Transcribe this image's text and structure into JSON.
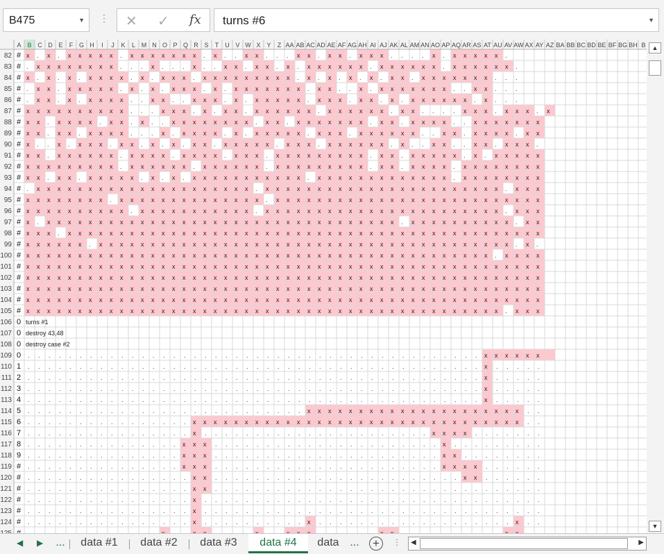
{
  "namebox": {
    "value": "B475"
  },
  "formula": {
    "value": "turns #6"
  },
  "function_icon": "fx",
  "columns": [
    "A",
    "B",
    "C",
    "D",
    "E",
    "F",
    "G",
    "H",
    "I",
    "J",
    "K",
    "L",
    "M",
    "N",
    "O",
    "P",
    "Q",
    "R",
    "S",
    "T",
    "U",
    "V",
    "W",
    "X",
    "Y",
    "Z",
    "AA",
    "AB",
    "AC",
    "AD",
    "AE",
    "AF",
    "AG",
    "AH",
    "AI",
    "AJ",
    "AK",
    "AL",
    "AM",
    "AN",
    "AO",
    "AP",
    "AQ",
    "AR",
    "AS",
    "AT",
    "AU",
    "AV",
    "AW",
    "AX",
    "AY",
    "AZ",
    "BA",
    "BB",
    "BC",
    "BD",
    "BE",
    "BF",
    "BG",
    "BH",
    "B"
  ],
  "row_numbers": [
    82,
    83,
    84,
    85,
    86,
    87,
    88,
    89,
    90,
    91,
    92,
    93,
    94,
    95,
    96,
    97,
    98,
    99,
    100,
    101,
    102,
    103,
    104,
    105,
    106,
    107,
    108,
    109,
    110,
    111,
    112,
    113,
    114,
    115,
    116,
    117,
    118,
    119,
    120,
    121,
    122,
    123,
    124,
    125
  ],
  "col_a_values": [
    "#",
    "#",
    "#",
    "#",
    "#",
    "#",
    "#",
    "#",
    "#",
    "#",
    "#",
    "#",
    "#",
    "#",
    "#",
    "#",
    "#",
    "#",
    "#",
    "#",
    "#",
    "#",
    "#",
    "#",
    "0",
    "0",
    "0",
    "0",
    "1",
    "2",
    "3",
    "4",
    "5",
    "6",
    "7",
    "8",
    "9",
    "#",
    "#",
    "#",
    "#",
    "#",
    "#",
    "#"
  ],
  "notes": [
    {
      "row_index": 24,
      "text": "turns #1"
    },
    {
      "row_index": 25,
      "text": "destroy 43,48"
    },
    {
      "row_index": 26,
      "text": "destroy case #2"
    }
  ],
  "pattern": {
    "mark": "x",
    "dot": ".",
    "block_rows": [
      "x.x.xxxxx.xxxxxxx.x..xx...xx.xx.xxx....x.xxxxx.",
      ".xxxxxxxx...x...x..xx.xx.x.xxxxxx.xxxxxx.xxxxxx.",
      "x.x.x.xxxx.x.xxx.xxxxxxxxx.x.x.x.x.xx.xxxxxxx...",
      ".xx.xxxxx.x.x.xxx.x.xxxxxxx.xx..x.xxxxxxx..xx...",
      ".xx.x.xxxx..xx..xxx.x.xxxxx.xxx.xx.x.xxxxxx.x...",
      "xxxxxxxxxx...xxx.x.xx.xxxxxx.xxxxxx.xx....xxx.xxx.x",
      "xx.xxxx.xx.x..xxxxxxxx.xx.xxxxxxx.xx.xxxx..xxxxxxx",
      "xx.xx.xxxx...x.xxxx.x.xxxxx.xxx.xxxxxx..xx.xxxx.xx",
      "x..x.xxx.xx.x.x.xx.xxxxx.xxx.xxxxxx.x..xx..xx.xxx.",
      "xx.xxxxxx.xxxx.xxxx.xxx.xxxxxxxxx.xx.xxxxx.x.xxxxx",
      "xxxxxxxxx.xxxxxx.xxxxxx.xxxxxxxxx.xx.xxxx.xxxxxxxx",
      "xx.xx.xxxxx.x.x.xxxxxxxxxxx.xxxxxxxxxxxxx.xxxxxxxx",
      ".xxxxxxxxxxxxxxxxxxxxx.xxxxxxxxxxxxxxxxxxxxxxx.xxx",
      "xxxxxxxx.xxxxxxxxxxxxxx.xxxxxxxxxxxxxxxxxxxxxxxxxx",
      "xxxxxxxxxx.xxxxxxxxxxx.xxxxxxxxxxxxxxxxxxxxxxx.xxx",
      "x.xxxxxxxxxxxxxxxxxxxxxxxxxxxxxxxxxx.xxxxxxxxxx.xx",
      "xxx.xxxxxxxxxxxxxxxxxxxxxxxxxxxxxxxxxxxxxxxxxxxxxx",
      "xxxxxx.xxxxxxxxxxxxxxxxxxxxxxxxxxxxxxxxxxxxxxxx.x.",
      "xxxxxxxxxxxxxxxxxxxxxxxxxxxxxxxxxxxxxxxxxxxxx.xxxx",
      "xxxxxxxxxxxxxxxxxxxxxxxxxxxxxxxxxxxxxxxxxxxxxxxxxx",
      "xxxxxxxxxxxxxxxxxxxxxxxxxxxxxxxxxxxxxxxxxxxxxxxxxx",
      "xxxxxxxxxxxxxxxxxxxxxxxxxxxxxxxxxxxxxxxxxxxxxxxxxx",
      "xxxxxxxxxxxxxxxxxxxxxxxxxxxxxxxxxxxxxxxxxxxxxxxxxx",
      "xxxxxxxxxxxxxxxxxxxxxxxxxxxxxxxxxxxxxxxxxxxxxx.xxx"
    ]
  },
  "tabs": [
    "data #1",
    "data #2",
    "data #3",
    "data #4",
    "data"
  ],
  "active_tab": "data #4",
  "tab_ellipsis": "...",
  "colors": {
    "accent": "#217346",
    "mark_fill": "#ffc7ce",
    "selected_header": "#d2e8d9",
    "header_bg": "#f3f3f3",
    "gridline": "#d9d9d9"
  }
}
